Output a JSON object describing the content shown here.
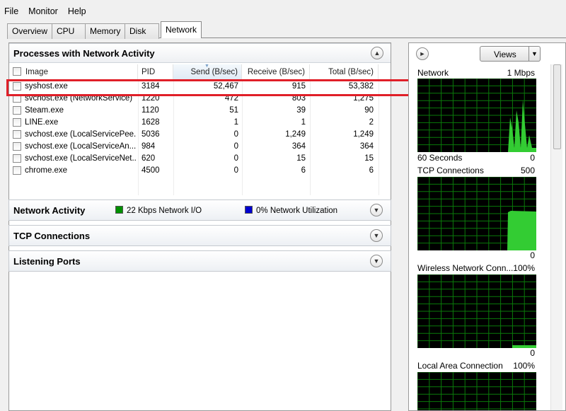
{
  "menu": [
    "File",
    "Monitor",
    "Help"
  ],
  "tabs": [
    {
      "label": "Overview"
    },
    {
      "label": "CPU"
    },
    {
      "label": "Memory"
    },
    {
      "label": "Disk"
    },
    {
      "label": "Network"
    }
  ],
  "processes": {
    "title": "Processes with Network Activity",
    "columns": [
      "Image",
      "PID",
      "Send (B/sec)",
      "Receive (B/sec)",
      "Total (B/sec)"
    ],
    "rows": [
      {
        "image": "syshost.exe",
        "pid": "3184",
        "send": "52,467",
        "receive": "915",
        "total": "53,382"
      },
      {
        "image": "svchost.exe (NetworkService)",
        "pid": "1220",
        "send": "472",
        "receive": "803",
        "total": "1,275"
      },
      {
        "image": "Steam.exe",
        "pid": "1120",
        "send": "51",
        "receive": "39",
        "total": "90"
      },
      {
        "image": "LINE.exe",
        "pid": "1628",
        "send": "1",
        "receive": "1",
        "total": "2"
      },
      {
        "image": "svchost.exe (LocalServicePee...",
        "pid": "5036",
        "send": "0",
        "receive": "1,249",
        "total": "1,249"
      },
      {
        "image": "svchost.exe (LocalServiceAn...",
        "pid": "984",
        "send": "0",
        "receive": "364",
        "total": "364"
      },
      {
        "image": "svchost.exe (LocalServiceNet...",
        "pid": "620",
        "send": "0",
        "receive": "15",
        "total": "15"
      },
      {
        "image": "chrome.exe",
        "pid": "4500",
        "send": "0",
        "receive": "6",
        "total": "6"
      }
    ]
  },
  "network_activity": {
    "title": "Network Activity",
    "io_label": "22 Kbps Network I/O",
    "util_label": "0% Network Utilization",
    "io_color": "#00a000",
    "util_color": "#0000d0"
  },
  "tcp_connections": {
    "title": "TCP Connections"
  },
  "listening_ports": {
    "title": "Listening Ports"
  },
  "right": {
    "views_label": "Views",
    "graphs": [
      {
        "title": "Network",
        "max": "1 Mbps",
        "footer_left": "60 Seconds",
        "footer_right": "0"
      },
      {
        "title": "TCP Connections",
        "max": "500",
        "footer_left": "",
        "footer_right": "0"
      },
      {
        "title": "Wireless Network Conn...",
        "max": "100%",
        "footer_left": "",
        "footer_right": "0"
      },
      {
        "title": "Local Area Connection",
        "max": "100%",
        "footer_left": "",
        "footer_right": ""
      }
    ]
  }
}
